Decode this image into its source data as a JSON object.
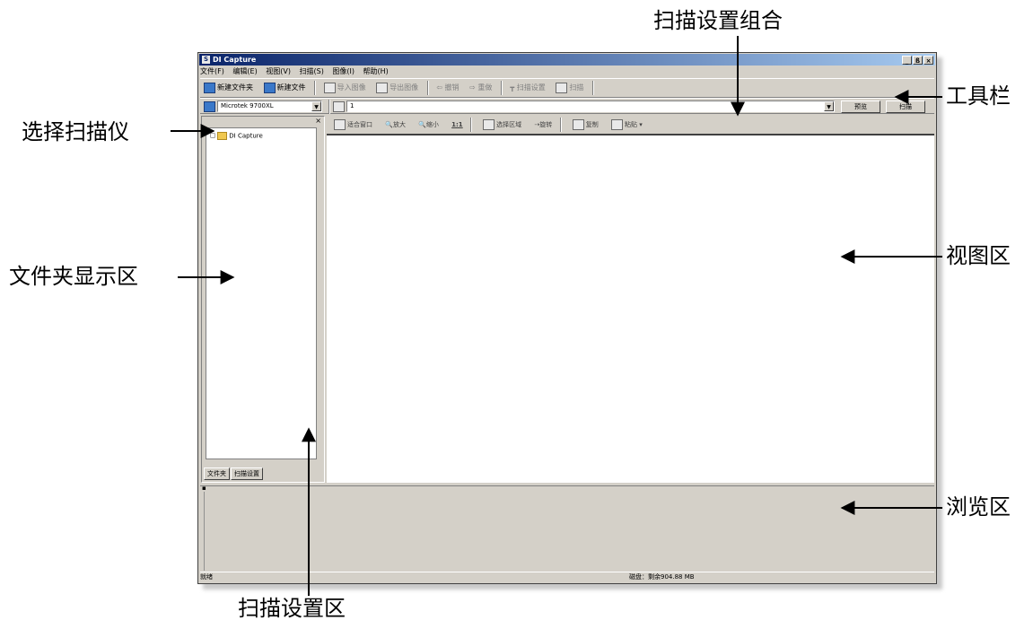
{
  "annotations": {
    "scan_settings_group": "扫描设置组合",
    "toolbar": "工具栏",
    "select_scanner": "选择扫描仪",
    "view_area": "视图区",
    "folder_area": "文件夹显示区",
    "browse_area": "浏览区",
    "scan_settings_area": "扫描设置区"
  },
  "window": {
    "title": "DI Capture",
    "buttons": [
      "_",
      "ß",
      "×"
    ]
  },
  "menu": [
    "文件(F)",
    "编辑(E)",
    "视图(V)",
    "扫描(S)",
    "图像(I)",
    "帮助(H)"
  ],
  "toolbar": {
    "items": [
      {
        "label": "新建文件夹",
        "icon": "new-folder-icon"
      },
      {
        "label": "新建文件",
        "icon": "new-file-icon"
      },
      {
        "label": "导入图像",
        "icon": "import-icon"
      },
      {
        "label": "导出图像",
        "icon": "export-icon"
      },
      {
        "label": "撤销",
        "icon": "undo-icon"
      },
      {
        "label": "重做",
        "icon": "redo-icon"
      },
      {
        "label": "扫描设置",
        "icon": "scan-settings-icon"
      },
      {
        "label": "扫描",
        "icon": "scan-icon"
      }
    ]
  },
  "scanner_select": {
    "value": "Microtek 9700XL"
  },
  "scan_profile": {
    "value": "1"
  },
  "buttons": {
    "preview": "预览",
    "scan": "扫描"
  },
  "folder_tree": {
    "root": "DI Capture"
  },
  "tabs": [
    "文件夹",
    "扫描设置"
  ],
  "view_toolbar": [
    "适合窗口",
    "放大",
    "缩小",
    "1:1",
    "选择区域",
    "旋转",
    "复制",
    "粘贴"
  ],
  "status": {
    "left": "就绪",
    "right": "磁盘：剩余904.88 MB"
  }
}
